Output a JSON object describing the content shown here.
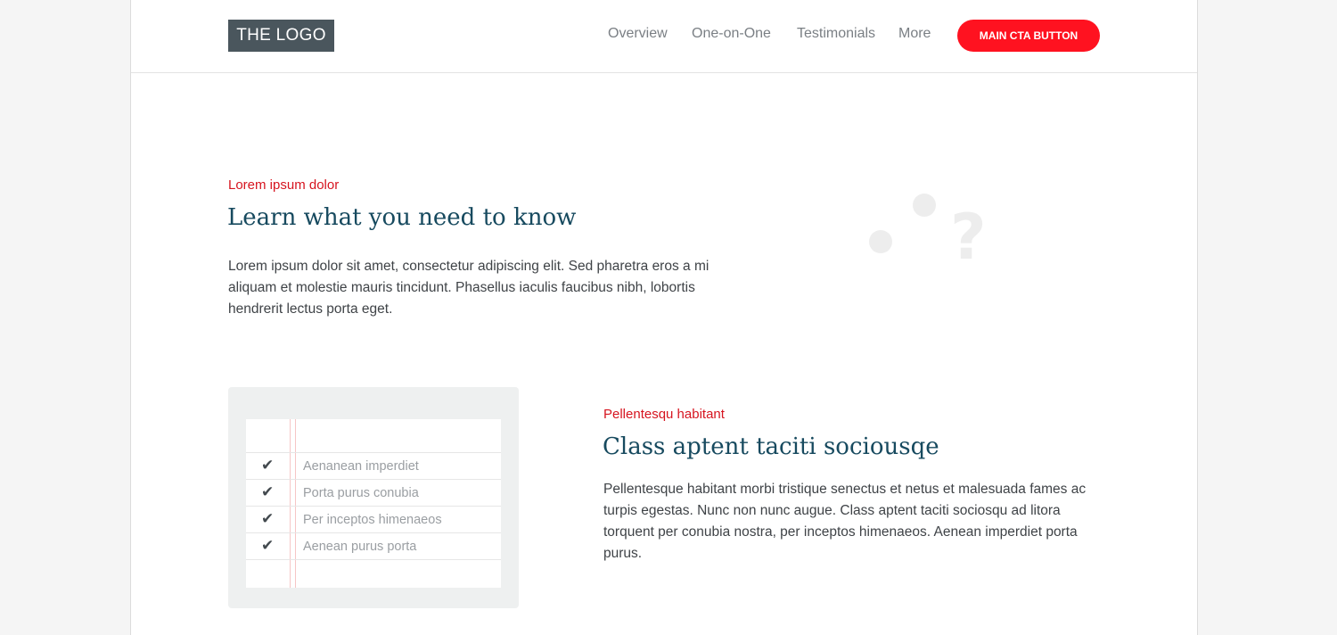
{
  "header": {
    "logo": "THE LOGO",
    "nav": [
      {
        "label": "Overview"
      },
      {
        "label": "One-on-One"
      },
      {
        "label": "Testimonials"
      },
      {
        "label": "More"
      }
    ],
    "cta_label": "MAIN CTA BUTTON"
  },
  "section1": {
    "eyebrow": "Lorem ipsum dolor",
    "heading": "Learn what you need to know",
    "body": "Lorem ipsum dolor sit amet, consectetur adipiscing elit. Sed pharetra eros a mi aliquam et molestie mauris tincidunt. Phasellus iaculis faucibus nibh, lobortis hendrerit lectus porta eget.",
    "illustration_glyph": "?"
  },
  "section2": {
    "eyebrow": "Pellentesqu habitant",
    "heading": "Class aptent taciti sociousqe",
    "body": "Pellentesque habitant morbi tristique senectus et netus et malesuada fames ac turpis egestas. Nunc non nunc augue. Class aptent taciti sociosqu ad litora torquent per conubia nostra, per inceptos himenaeos. Aenean imperdiet porta purus.",
    "checklist": [
      {
        "icon": "checkmark-icon",
        "glyph": "✔",
        "label": "Aenanean imperdiet"
      },
      {
        "icon": "checkmark-icon",
        "glyph": "✔",
        "label": "Porta purus conubia"
      },
      {
        "icon": "checkmark-icon",
        "glyph": "✔",
        "label": "Per inceptos himenaeos"
      },
      {
        "icon": "checkmark-icon",
        "glyph": "✔",
        "label": "Aenean purus porta"
      }
    ]
  },
  "colors": {
    "accent": "#ff1220",
    "eyebrow": "#d6141f",
    "heading": "#174a5f",
    "logo_bg": "#4a565d"
  }
}
